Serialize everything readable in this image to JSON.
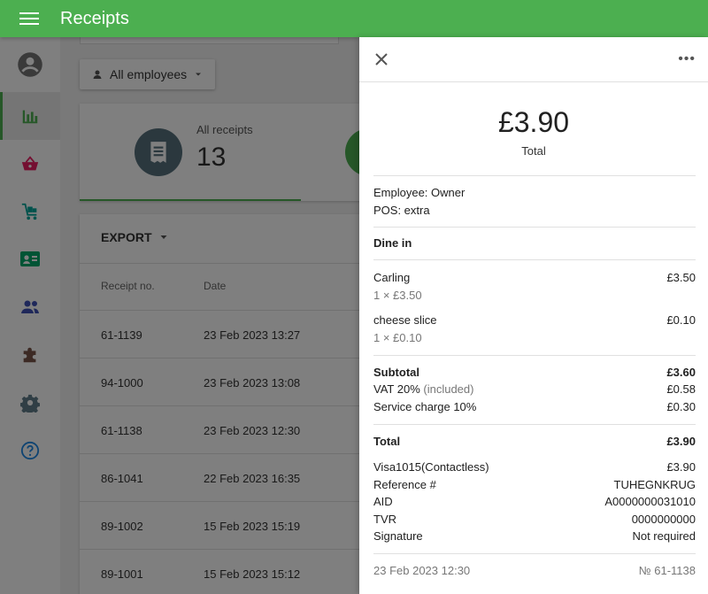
{
  "app": {
    "title": "Receipts",
    "accent": "#4caf50"
  },
  "sidebar": {
    "items": [
      {
        "name": "profile",
        "icon": "account-circle-icon",
        "color": "#757575"
      },
      {
        "name": "reports",
        "icon": "bar-chart-icon",
        "color": "#4caf50",
        "active": true
      },
      {
        "name": "items",
        "icon": "basket-icon",
        "color": "#e91e63"
      },
      {
        "name": "inventory",
        "icon": "cart-icon",
        "color": "#00a499"
      },
      {
        "name": "employees",
        "icon": "id-card-icon",
        "color": "#00a86b"
      },
      {
        "name": "customers",
        "icon": "people-icon",
        "color": "#3f51b5"
      },
      {
        "name": "integrations",
        "icon": "puzzle-icon",
        "color": "#795548"
      },
      {
        "name": "settings",
        "icon": "gear-icon",
        "color": "#607d8b"
      },
      {
        "name": "help",
        "icon": "help-icon",
        "color": "#1e88e5"
      }
    ]
  },
  "filters": {
    "employees_label": "All employees"
  },
  "summary": {
    "label": "All receipts",
    "value": "13"
  },
  "table": {
    "export_label": "EXPORT",
    "headers": [
      "Receipt no.",
      "Date"
    ],
    "rows": [
      {
        "no": "61-1139",
        "date": "23 Feb 2023 13:27"
      },
      {
        "no": "94-1000",
        "date": "23 Feb 2023 13:08"
      },
      {
        "no": "61-1138",
        "date": "23 Feb 2023 12:30"
      },
      {
        "no": "86-1041",
        "date": "22 Feb 2023 16:35"
      },
      {
        "no": "89-1002",
        "date": "15 Feb 2023 15:19"
      },
      {
        "no": "89-1001",
        "date": "15 Feb 2023 15:12"
      }
    ]
  },
  "receipt": {
    "more_label": "•••",
    "total_amount": "£3.90",
    "total_caption": "Total",
    "employee": "Employee: Owner",
    "pos": "POS: extra",
    "dining": "Dine in",
    "items": [
      {
        "name": "Carling",
        "qty": "1 × £3.50",
        "price": "£3.50"
      },
      {
        "name": "cheese slice",
        "qty": "1 × £0.10",
        "price": "£0.10"
      }
    ],
    "subtotal_label": "Subtotal",
    "subtotal_value": "£3.60",
    "vat_label": "VAT 20%",
    "vat_note": "(included)",
    "vat_value": "£0.58",
    "service_label": "Service charge 10%",
    "service_value": "£0.30",
    "total_label": "Total",
    "total_value": "£3.90",
    "payment": [
      {
        "label": "Visa1015(Contactless)",
        "value": "£3.90"
      },
      {
        "label": "Reference #",
        "value": "TUHEGNKRUG"
      },
      {
        "label": "AID",
        "value": "A0000000031010"
      },
      {
        "label": "TVR",
        "value": "0000000000"
      },
      {
        "label": "Signature",
        "value": "Not required"
      }
    ],
    "footer_date": "23 Feb 2023 12:30",
    "footer_number": "№ 61-1138"
  }
}
